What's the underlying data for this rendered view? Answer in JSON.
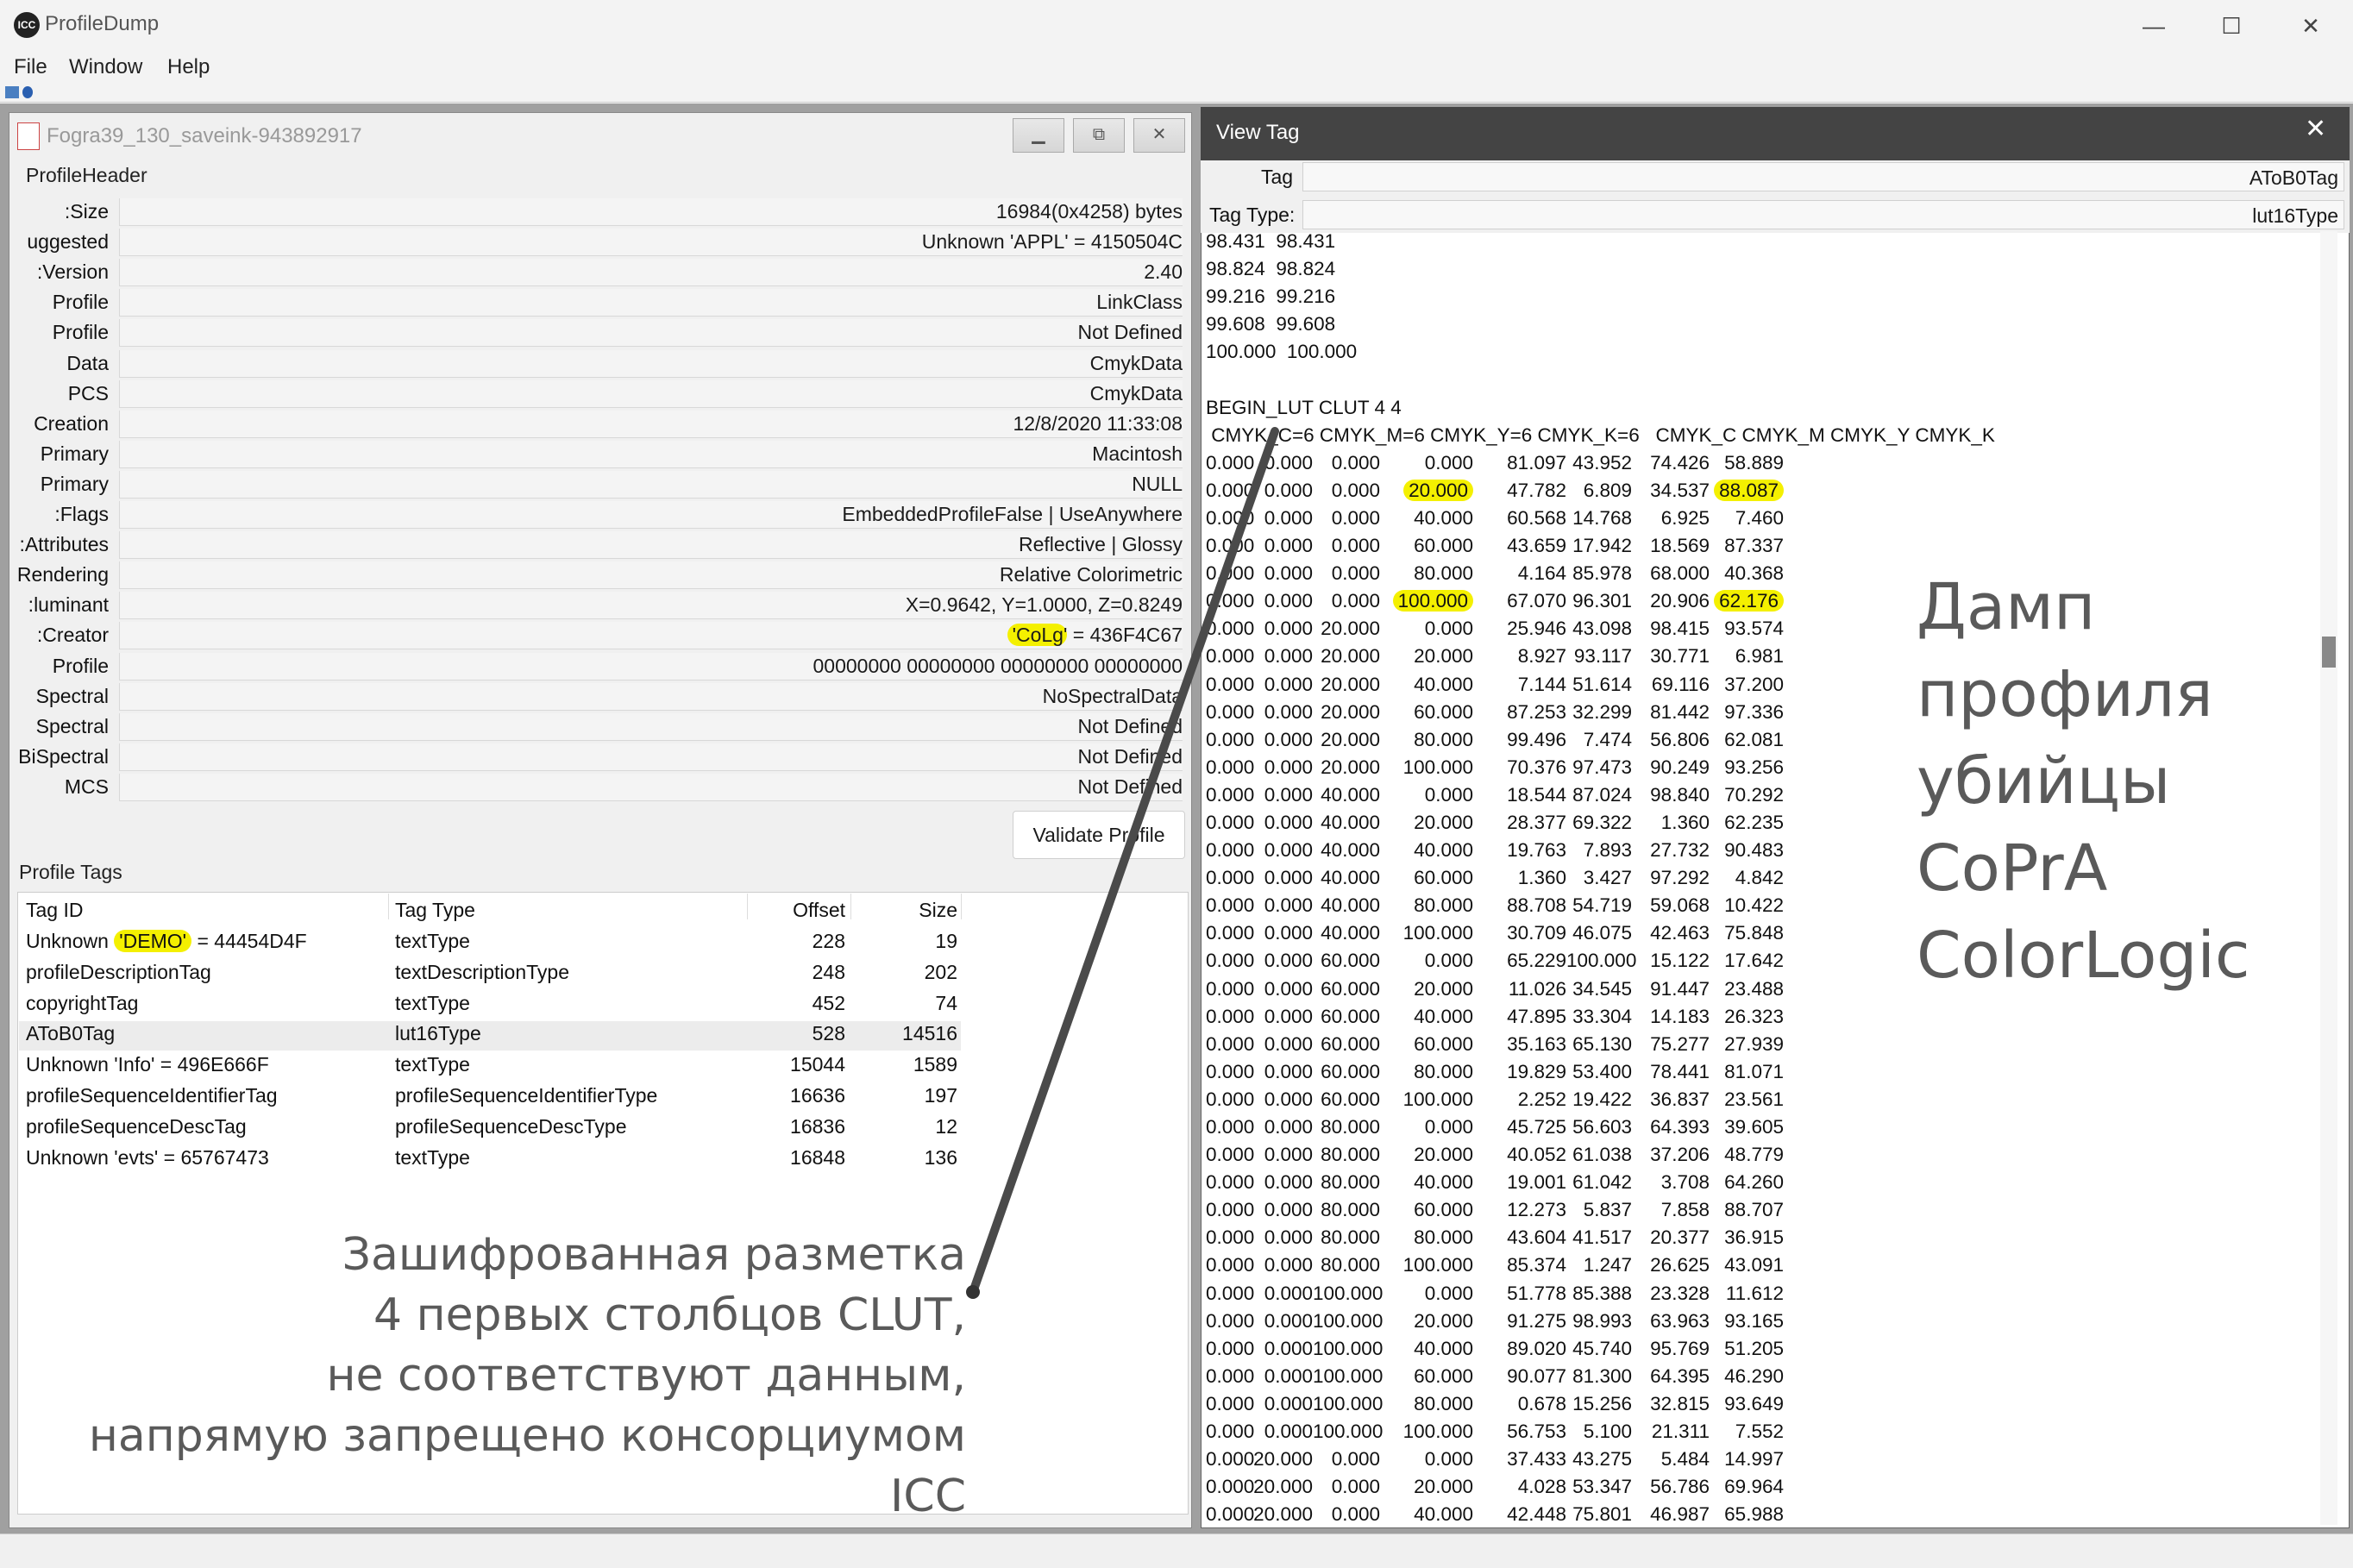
{
  "app": {
    "title": "ProfileDump",
    "icon": "icc-app-icon",
    "controls": {
      "minimize": "—",
      "maximize": "☐",
      "close": "✕"
    }
  },
  "menu": [
    "File",
    "Window",
    "Help"
  ],
  "child_window": {
    "title": "Fogra39_130_saveink-943892917",
    "group_header": "ProfileHeader",
    "header_rows": [
      {
        "label": "Size:",
        "value": "16984(0x4258) bytes"
      },
      {
        "label": "uggested",
        "value": "Unknown 'APPL' = 4150504C"
      },
      {
        "label": "Version:",
        "value": "2.40"
      },
      {
        "label": "Profile",
        "value": "LinkClass"
      },
      {
        "label": "Profile",
        "value": "Not Defined"
      },
      {
        "label": "Data",
        "value": "CmykData"
      },
      {
        "label": "PCS",
        "value": "CmykData"
      },
      {
        "label": "Creation",
        "value": "12/8/2020 11:33:08"
      },
      {
        "label": "Primary",
        "value": "Macintosh"
      },
      {
        "label": "Primary",
        "value": "NULL"
      },
      {
        "label": "Flags:",
        "value": "EmbeddedProfileFalse | UseAnywhere"
      },
      {
        "label": "Attributes:",
        "value": "Reflective | Glossy"
      },
      {
        "label": "Rendering",
        "value": "Relative Colorimetric"
      },
      {
        "label": "luminant:",
        "value": "X=0.9642, Y=1.0000, Z=0.8249"
      },
      {
        "label": "Creator:",
        "value_highlight": "'CoLg'",
        "value": " = 436F4C67"
      },
      {
        "label": "Profile",
        "value": "00000000 00000000 00000000 00000000"
      },
      {
        "label": "Spectral",
        "value": "NoSpectralData"
      },
      {
        "label": "Spectral",
        "value": "Not Defined"
      },
      {
        "label": "BiSpectral",
        "value": "Not Defined"
      },
      {
        "label": "MCS",
        "value": "Not Defined"
      }
    ],
    "validate_button": "Validate Profile",
    "tags_group": "Profile Tags",
    "tags_columns": [
      "Tag ID",
      "Tag Type",
      "Offset",
      "Size"
    ],
    "tags_rows": [
      {
        "id_pre": "Unknown ",
        "id_hl": "'DEMO'",
        "id_post": " = 44454D4F",
        "type": "textType",
        "offset": "228",
        "size": "19"
      },
      {
        "id_pre": "profileDescriptionTag",
        "id_hl": "",
        "id_post": "",
        "type": "textDescriptionType",
        "offset": "248",
        "size": "202"
      },
      {
        "id_pre": "copyrightTag",
        "id_hl": "",
        "id_post": "",
        "type": "textType",
        "offset": "452",
        "size": "74"
      },
      {
        "id_pre": "AToB0Tag",
        "id_hl": "",
        "id_post": "",
        "type": "lut16Type",
        "offset": "528",
        "size": "14516"
      },
      {
        "id_pre": "Unknown 'Info' = 496E666F",
        "id_hl": "",
        "id_post": "",
        "type": "textType",
        "offset": "15044",
        "size": "1589"
      },
      {
        "id_pre": "profileSequenceIdentifierTag",
        "id_hl": "",
        "id_post": "",
        "type": "profileSequenceIdentifierType",
        "offset": "16636",
        "size": "197"
      },
      {
        "id_pre": "profileSequenceDescTag",
        "id_hl": "",
        "id_post": "",
        "type": "profileSequenceDescType",
        "offset": "16836",
        "size": "12"
      },
      {
        "id_pre": "Unknown 'evts' = 65767473",
        "id_hl": "",
        "id_post": "",
        "type": "textType",
        "offset": "16848",
        "size": "136"
      }
    ]
  },
  "view_tag": {
    "title": "View Tag",
    "tag_label": "Tag",
    "tag_value": "AToB0Tag",
    "type_label": "Tag Type:",
    "type_value": "lut16Type",
    "curve_lines": [
      "98.431  98.431",
      "98.824  98.824",
      "99.216  99.216",
      "99.608  99.608",
      "100.000  100.000"
    ],
    "clut_title": "BEGIN_LUT CLUT 4 4",
    "clut_header": " CMYK_C=6 CMYK_M=6 CMYK_Y=6 CMYK_K=6   CMYK_C CMYK_M CMYK_Y CMYK_K",
    "clut_rows": [
      [
        "0.000",
        "0.000",
        "0.000",
        "0.000",
        "81.097",
        "43.952",
        "74.426",
        "58.889"
      ],
      [
        "0.000",
        "0.000",
        "0.000",
        "*20.000",
        "47.782",
        "6.809",
        "34.537",
        "*88.087"
      ],
      [
        "0.000",
        "0.000",
        "0.000",
        "40.000",
        "60.568",
        "14.768",
        "6.925",
        "7.460"
      ],
      [
        "0.000",
        "0.000",
        "0.000",
        "60.000",
        "43.659",
        "17.942",
        "18.569",
        "87.337"
      ],
      [
        "0.000",
        "0.000",
        "0.000",
        "80.000",
        "4.164",
        "85.978",
        "68.000",
        "40.368"
      ],
      [
        "0.000",
        "0.000",
        "0.000",
        "*100.000",
        "67.070",
        "96.301",
        "20.906",
        "*62.176"
      ],
      [
        "0.000",
        "0.000",
        "20.000",
        "0.000",
        "25.946",
        "43.098",
        "98.415",
        "93.574"
      ],
      [
        "0.000",
        "0.000",
        "20.000",
        "20.000",
        "8.927",
        "93.117",
        "30.771",
        "6.981"
      ],
      [
        "0.000",
        "0.000",
        "20.000",
        "40.000",
        "7.144",
        "51.614",
        "69.116",
        "37.200"
      ],
      [
        "0.000",
        "0.000",
        "20.000",
        "60.000",
        "87.253",
        "32.299",
        "81.442",
        "97.336"
      ],
      [
        "0.000",
        "0.000",
        "20.000",
        "80.000",
        "99.496",
        "7.474",
        "56.806",
        "62.081"
      ],
      [
        "0.000",
        "0.000",
        "20.000",
        "100.000",
        "70.376",
        "97.473",
        "90.249",
        "93.256"
      ],
      [
        "0.000",
        "0.000",
        "40.000",
        "0.000",
        "18.544",
        "87.024",
        "98.840",
        "70.292"
      ],
      [
        "0.000",
        "0.000",
        "40.000",
        "20.000",
        "28.377",
        "69.322",
        "1.360",
        "62.235"
      ],
      [
        "0.000",
        "0.000",
        "40.000",
        "40.000",
        "19.763",
        "7.893",
        "27.732",
        "90.483"
      ],
      [
        "0.000",
        "0.000",
        "40.000",
        "60.000",
        "1.360",
        "3.427",
        "97.292",
        "4.842"
      ],
      [
        "0.000",
        "0.000",
        "40.000",
        "80.000",
        "88.708",
        "54.719",
        "59.068",
        "10.422"
      ],
      [
        "0.000",
        "0.000",
        "40.000",
        "100.000",
        "30.709",
        "46.075",
        "42.463",
        "75.848"
      ],
      [
        "0.000",
        "0.000",
        "60.000",
        "0.000",
        "65.229",
        "100.000",
        "15.122",
        "17.642"
      ],
      [
        "0.000",
        "0.000",
        "60.000",
        "20.000",
        "11.026",
        "34.545",
        "91.447",
        "23.488"
      ],
      [
        "0.000",
        "0.000",
        "60.000",
        "40.000",
        "47.895",
        "33.304",
        "14.183",
        "26.323"
      ],
      [
        "0.000",
        "0.000",
        "60.000",
        "60.000",
        "35.163",
        "65.130",
        "75.277",
        "27.939"
      ],
      [
        "0.000",
        "0.000",
        "60.000",
        "80.000",
        "19.829",
        "53.400",
        "78.441",
        "81.071"
      ],
      [
        "0.000",
        "0.000",
        "60.000",
        "100.000",
        "2.252",
        "19.422",
        "36.837",
        "23.561"
      ],
      [
        "0.000",
        "0.000",
        "80.000",
        "0.000",
        "45.725",
        "56.603",
        "64.393",
        "39.605"
      ],
      [
        "0.000",
        "0.000",
        "80.000",
        "20.000",
        "40.052",
        "61.038",
        "37.206",
        "48.779"
      ],
      [
        "0.000",
        "0.000",
        "80.000",
        "40.000",
        "19.001",
        "61.042",
        "3.708",
        "64.260"
      ],
      [
        "0.000",
        "0.000",
        "80.000",
        "60.000",
        "12.273",
        "5.837",
        "7.858",
        "88.707"
      ],
      [
        "0.000",
        "0.000",
        "80.000",
        "80.000",
        "43.604",
        "41.517",
        "20.377",
        "36.915"
      ],
      [
        "0.000",
        "0.000",
        "80.000",
        "100.000",
        "85.374",
        "1.247",
        "26.625",
        "43.091"
      ],
      [
        "0.000",
        "0.000",
        "100.000",
        "0.000",
        "51.778",
        "85.388",
        "23.328",
        "11.612"
      ],
      [
        "0.000",
        "0.000",
        "100.000",
        "20.000",
        "91.275",
        "98.993",
        "63.963",
        "93.165"
      ],
      [
        "0.000",
        "0.000",
        "100.000",
        "40.000",
        "89.020",
        "45.740",
        "95.769",
        "51.205"
      ],
      [
        "0.000",
        "0.000",
        "100.000",
        "60.000",
        "90.077",
        "81.300",
        "64.395",
        "46.290"
      ],
      [
        "0.000",
        "0.000",
        "100.000",
        "80.000",
        "0.678",
        "15.256",
        "32.815",
        "93.649"
      ],
      [
        "0.000",
        "0.000",
        "100.000",
        "100.000",
        "56.753",
        "5.100",
        "21.311",
        "7.552"
      ],
      [
        "0.000",
        "20.000",
        "0.000",
        "0.000",
        "37.433",
        "43.275",
        "5.484",
        "14.997"
      ],
      [
        "0.000",
        "20.000",
        "0.000",
        "20.000",
        "4.028",
        "53.347",
        "56.786",
        "69.964"
      ],
      [
        "0.000",
        "20.000",
        "0.000",
        "40.000",
        "42.448",
        "75.801",
        "46.987",
        "65.988"
      ]
    ]
  },
  "annotations": {
    "right_lines": [
      "Дамп",
      "профиля",
      "убийцы",
      "CoPrA",
      "ColorLogic"
    ],
    "left_lines": [
      "Зашифрованная разметка",
      "4 первых столбцов CLUT,",
      "не соответствуют данным,",
      "напрямую запрещено консорциумом ICC"
    ]
  },
  "colors": {
    "highlight": "#f4f000",
    "annotation": "#5a5a5a",
    "viewtag_titlebar": "#444444"
  }
}
